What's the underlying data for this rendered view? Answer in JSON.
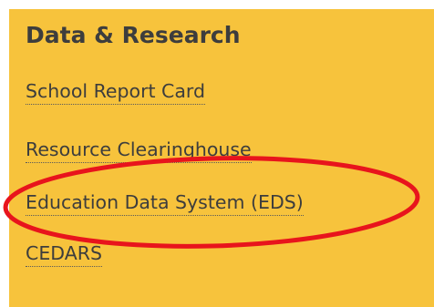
{
  "panel": {
    "heading": "Data & Research",
    "links": [
      {
        "label": "School Report Card"
      },
      {
        "label": "Resource Clearinghouse"
      },
      {
        "label": "Education Data System (EDS)"
      },
      {
        "label": "CEDARS"
      }
    ]
  },
  "colors": {
    "panel_background": "#f7c33c",
    "text": "#3d3d3d",
    "highlight_ellipse": "#e8141c"
  },
  "highlight": {
    "target": "Education Data System (EDS)"
  }
}
